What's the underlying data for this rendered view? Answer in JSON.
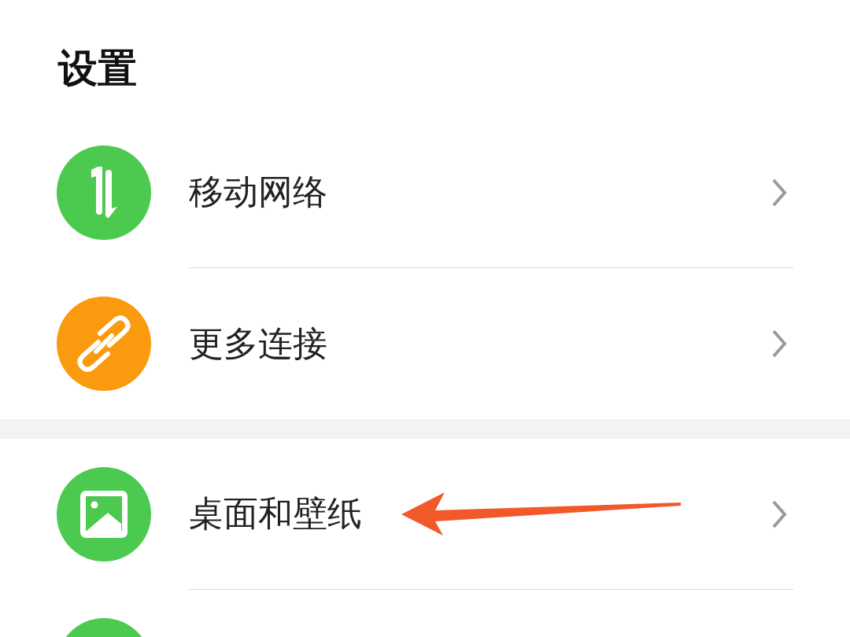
{
  "title": "设置",
  "sections": [
    {
      "items": [
        {
          "kind": "network",
          "label": "移动网络",
          "color": "#4cc94f",
          "annotated": false
        },
        {
          "kind": "link",
          "label": "更多连接",
          "color": "#fa9a0e",
          "annotated": false
        }
      ]
    },
    {
      "items": [
        {
          "kind": "picture",
          "label": "桌面和壁纸",
          "color": "#4cc94f",
          "annotated": true
        },
        {
          "kind": "blank",
          "color": "#4cc94f",
          "annotated": false
        }
      ]
    }
  ]
}
